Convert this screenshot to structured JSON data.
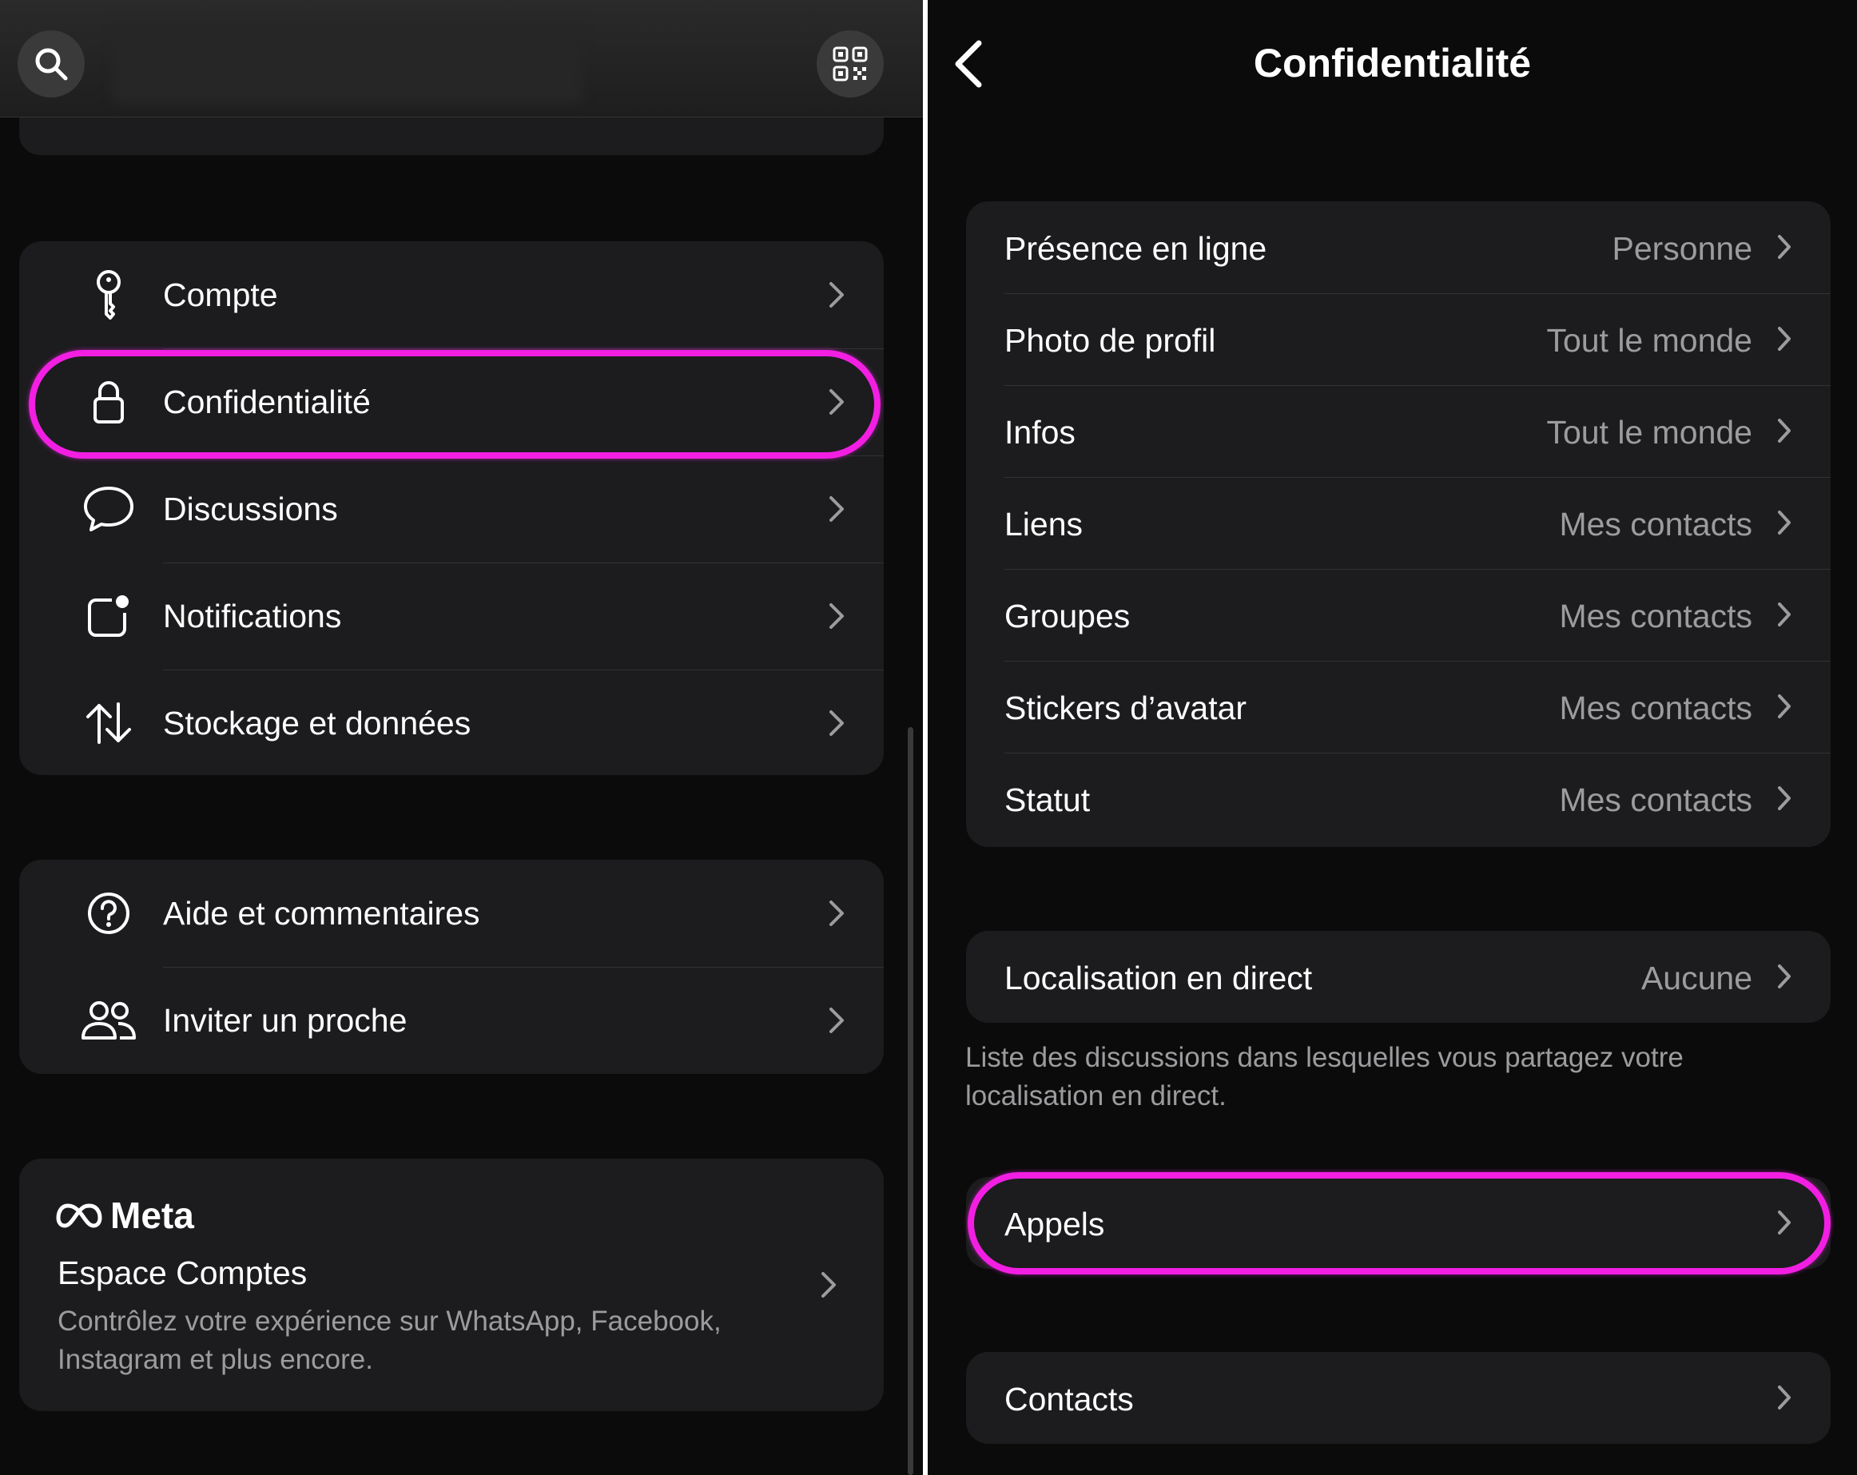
{
  "colors": {
    "accent_highlight": "#f21fe3",
    "card_bg": "#1c1c1e",
    "secondary_text": "#9c9c9f"
  },
  "left": {
    "header": {
      "search_icon": "search-icon",
      "qr_icon": "qr-code-icon"
    },
    "settings_group1": [
      {
        "label": "Compte",
        "icon": "key-icon"
      },
      {
        "label": "Confidentialité",
        "icon": "lock-icon"
      },
      {
        "label": "Discussions",
        "icon": "chat-bubble-icon"
      },
      {
        "label": "Notifications",
        "icon": "notification-badge-icon"
      },
      {
        "label": "Stockage et données",
        "icon": "up-down-arrows-icon"
      }
    ],
    "settings_group2": [
      {
        "label": "Aide et commentaires",
        "icon": "help-circle-icon"
      },
      {
        "label": "Inviter un proche",
        "icon": "people-icon"
      }
    ],
    "meta_card": {
      "brand": "Meta",
      "title": "Espace Comptes",
      "description": "Contrôlez votre expérience sur WhatsApp, Facebook, Instagram et plus encore."
    }
  },
  "right": {
    "title": "Confidentialité",
    "privacy_rows": [
      {
        "label": "Présence en ligne",
        "value": "Personne"
      },
      {
        "label": "Photo de profil",
        "value": "Tout le monde"
      },
      {
        "label": "Infos",
        "value": "Tout le monde"
      },
      {
        "label": "Liens",
        "value": "Mes contacts"
      },
      {
        "label": "Groupes",
        "value": "Mes contacts"
      },
      {
        "label": "Stickers d’avatar",
        "value": "Mes contacts"
      },
      {
        "label": "Statut",
        "value": "Mes contacts"
      }
    ],
    "live_location": {
      "label": "Localisation en direct",
      "value": "Aucune"
    },
    "live_location_note": "Liste des discussions dans lesquelles vous partagez votre localisation en direct.",
    "calls": {
      "label": "Appels"
    },
    "contacts": {
      "label": "Contacts"
    }
  }
}
